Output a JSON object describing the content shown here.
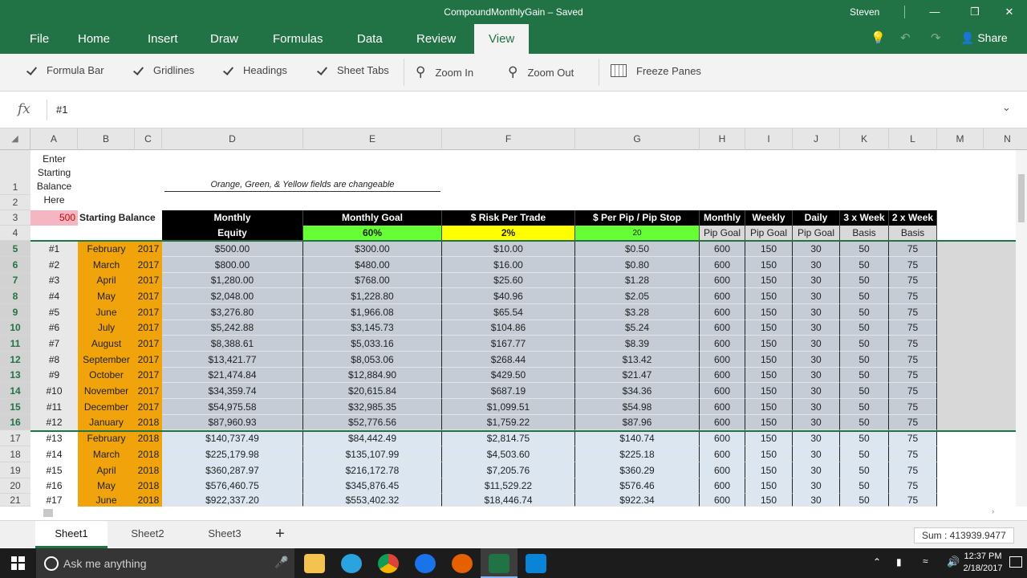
{
  "titlebar": {
    "title": "CompoundMonthlyGain – Saved",
    "user": "Steven"
  },
  "ribbon_tabs": [
    "File",
    "Home",
    "Insert",
    "Draw",
    "Formulas",
    "Data",
    "Review",
    "View"
  ],
  "ribbon_right": {
    "share": "Share"
  },
  "view_options": {
    "formula_bar": "Formula Bar",
    "gridlines": "Gridlines",
    "headings": "Headings",
    "sheet_tabs": "Sheet Tabs",
    "zoom_in": "Zoom In",
    "zoom_out": "Zoom Out",
    "freeze_panes": "Freeze Panes"
  },
  "formula_bar": {
    "fx": "fx",
    "value": "#1"
  },
  "columns": [
    "A",
    "B",
    "C",
    "D",
    "E",
    "F",
    "G",
    "H",
    "I",
    "J",
    "K",
    "L",
    "M",
    "N"
  ],
  "row_numbers": [
    "1",
    "2",
    "3",
    "4",
    "5",
    "6",
    "7",
    "8",
    "9",
    "10",
    "11",
    "12",
    "13",
    "14",
    "15",
    "16",
    "17",
    "18",
    "19",
    "20",
    "21"
  ],
  "header": {
    "a1": [
      "Enter",
      "Starting",
      "Balance",
      "Here"
    ],
    "note": "Orange, Green, & Yellow fields are changeable",
    "a3": "500",
    "b3": "Starting Balance",
    "d3": "Monthly",
    "d4": "Equity",
    "e3": "Monthly Goal",
    "e4": "60%",
    "f3": "$ Risk Per Trade",
    "f4": "2%",
    "g3": "$ Per Pip / Pip Stop",
    "g4": "20",
    "h3": "Monthly",
    "h4": "Pip Goal",
    "i3": "Weekly",
    "i4": "Pip Goal",
    "j3": "Daily",
    "j4": "Pip Goal",
    "k3": "3 x Week",
    "k4": "Basis",
    "l3": "2 x Week",
    "l4": "Basis"
  },
  "rows": [
    {
      "num": "#1",
      "month": "February",
      "year": "2017",
      "equity": "$500.00",
      "goal": "$300.00",
      "risk": "$10.00",
      "pip": "$0.50",
      "h": "600",
      "i": "150",
      "j": "30",
      "k": "50",
      "l": "75"
    },
    {
      "num": "#2",
      "month": "March",
      "year": "2017",
      "equity": "$800.00",
      "goal": "$480.00",
      "risk": "$16.00",
      "pip": "$0.80",
      "h": "600",
      "i": "150",
      "j": "30",
      "k": "50",
      "l": "75"
    },
    {
      "num": "#3",
      "month": "April",
      "year": "2017",
      "equity": "$1,280.00",
      "goal": "$768.00",
      "risk": "$25.60",
      "pip": "$1.28",
      "h": "600",
      "i": "150",
      "j": "30",
      "k": "50",
      "l": "75"
    },
    {
      "num": "#4",
      "month": "May",
      "year": "2017",
      "equity": "$2,048.00",
      "goal": "$1,228.80",
      "risk": "$40.96",
      "pip": "$2.05",
      "h": "600",
      "i": "150",
      "j": "30",
      "k": "50",
      "l": "75"
    },
    {
      "num": "#5",
      "month": "June",
      "year": "2017",
      "equity": "$3,276.80",
      "goal": "$1,966.08",
      "risk": "$65.54",
      "pip": "$3.28",
      "h": "600",
      "i": "150",
      "j": "30",
      "k": "50",
      "l": "75"
    },
    {
      "num": "#6",
      "month": "July",
      "year": "2017",
      "equity": "$5,242.88",
      "goal": "$3,145.73",
      "risk": "$104.86",
      "pip": "$5.24",
      "h": "600",
      "i": "150",
      "j": "30",
      "k": "50",
      "l": "75"
    },
    {
      "num": "#7",
      "month": "August",
      "year": "2017",
      "equity": "$8,388.61",
      "goal": "$5,033.16",
      "risk": "$167.77",
      "pip": "$8.39",
      "h": "600",
      "i": "150",
      "j": "30",
      "k": "50",
      "l": "75"
    },
    {
      "num": "#8",
      "month": "September",
      "year": "2017",
      "equity": "$13,421.77",
      "goal": "$8,053.06",
      "risk": "$268.44",
      "pip": "$13.42",
      "h": "600",
      "i": "150",
      "j": "30",
      "k": "50",
      "l": "75"
    },
    {
      "num": "#9",
      "month": "October",
      "year": "2017",
      "equity": "$21,474.84",
      "goal": "$12,884.90",
      "risk": "$429.50",
      "pip": "$21.47",
      "h": "600",
      "i": "150",
      "j": "30",
      "k": "50",
      "l": "75"
    },
    {
      "num": "#10",
      "month": "November",
      "year": "2017",
      "equity": "$34,359.74",
      "goal": "$20,615.84",
      "risk": "$687.19",
      "pip": "$34.36",
      "h": "600",
      "i": "150",
      "j": "30",
      "k": "50",
      "l": "75"
    },
    {
      "num": "#11",
      "month": "December",
      "year": "2017",
      "equity": "$54,975.58",
      "goal": "$32,985.35",
      "risk": "$1,099.51",
      "pip": "$54.98",
      "h": "600",
      "i": "150",
      "j": "30",
      "k": "50",
      "l": "75"
    },
    {
      "num": "#12",
      "month": "January",
      "year": "2018",
      "equity": "$87,960.93",
      "goal": "$52,776.56",
      "risk": "$1,759.22",
      "pip": "$87.96",
      "h": "600",
      "i": "150",
      "j": "30",
      "k": "50",
      "l": "75"
    },
    {
      "num": "#13",
      "month": "February",
      "year": "2018",
      "equity": "$140,737.49",
      "goal": "$84,442.49",
      "risk": "$2,814.75",
      "pip": "$140.74",
      "h": "600",
      "i": "150",
      "j": "30",
      "k": "50",
      "l": "75"
    },
    {
      "num": "#14",
      "month": "March",
      "year": "2018",
      "equity": "$225,179.98",
      "goal": "$135,107.99",
      "risk": "$4,503.60",
      "pip": "$225.18",
      "h": "600",
      "i": "150",
      "j": "30",
      "k": "50",
      "l": "75"
    },
    {
      "num": "#15",
      "month": "April",
      "year": "2018",
      "equity": "$360,287.97",
      "goal": "$216,172.78",
      "risk": "$7,205.76",
      "pip": "$360.29",
      "h": "600",
      "i": "150",
      "j": "30",
      "k": "50",
      "l": "75"
    },
    {
      "num": "#16",
      "month": "May",
      "year": "2018",
      "equity": "$576,460.75",
      "goal": "$345,876.45",
      "risk": "$11,529.22",
      "pip": "$576.46",
      "h": "600",
      "i": "150",
      "j": "30",
      "k": "50",
      "l": "75"
    },
    {
      "num": "#17",
      "month": "June",
      "year": "2018",
      "equity": "$922,337.20",
      "goal": "$553,402.32",
      "risk": "$18,446.74",
      "pip": "$922.34",
      "h": "600",
      "i": "150",
      "j": "30",
      "k": "50",
      "l": "75"
    }
  ],
  "selected_rows": [
    "5",
    "6",
    "7",
    "8",
    "9",
    "10",
    "11",
    "12",
    "13",
    "14",
    "15",
    "16"
  ],
  "sheets": [
    "Sheet1",
    "Sheet2",
    "Sheet3"
  ],
  "status": {
    "sum": "Sum : 413939.9477"
  },
  "taskbar": {
    "search_placeholder": "Ask me anything",
    "time": "12:37 PM",
    "date": "2/18/2017"
  },
  "colors": {
    "excel_green": "#217346",
    "orange": "#f0a30a",
    "pink": "#f4b6c2",
    "bright_green": "#66ff33",
    "yellow": "#ffff00",
    "header_black": "#000000",
    "selection_fill": "#c5ccd6",
    "data_fill": "#dce6f1"
  }
}
